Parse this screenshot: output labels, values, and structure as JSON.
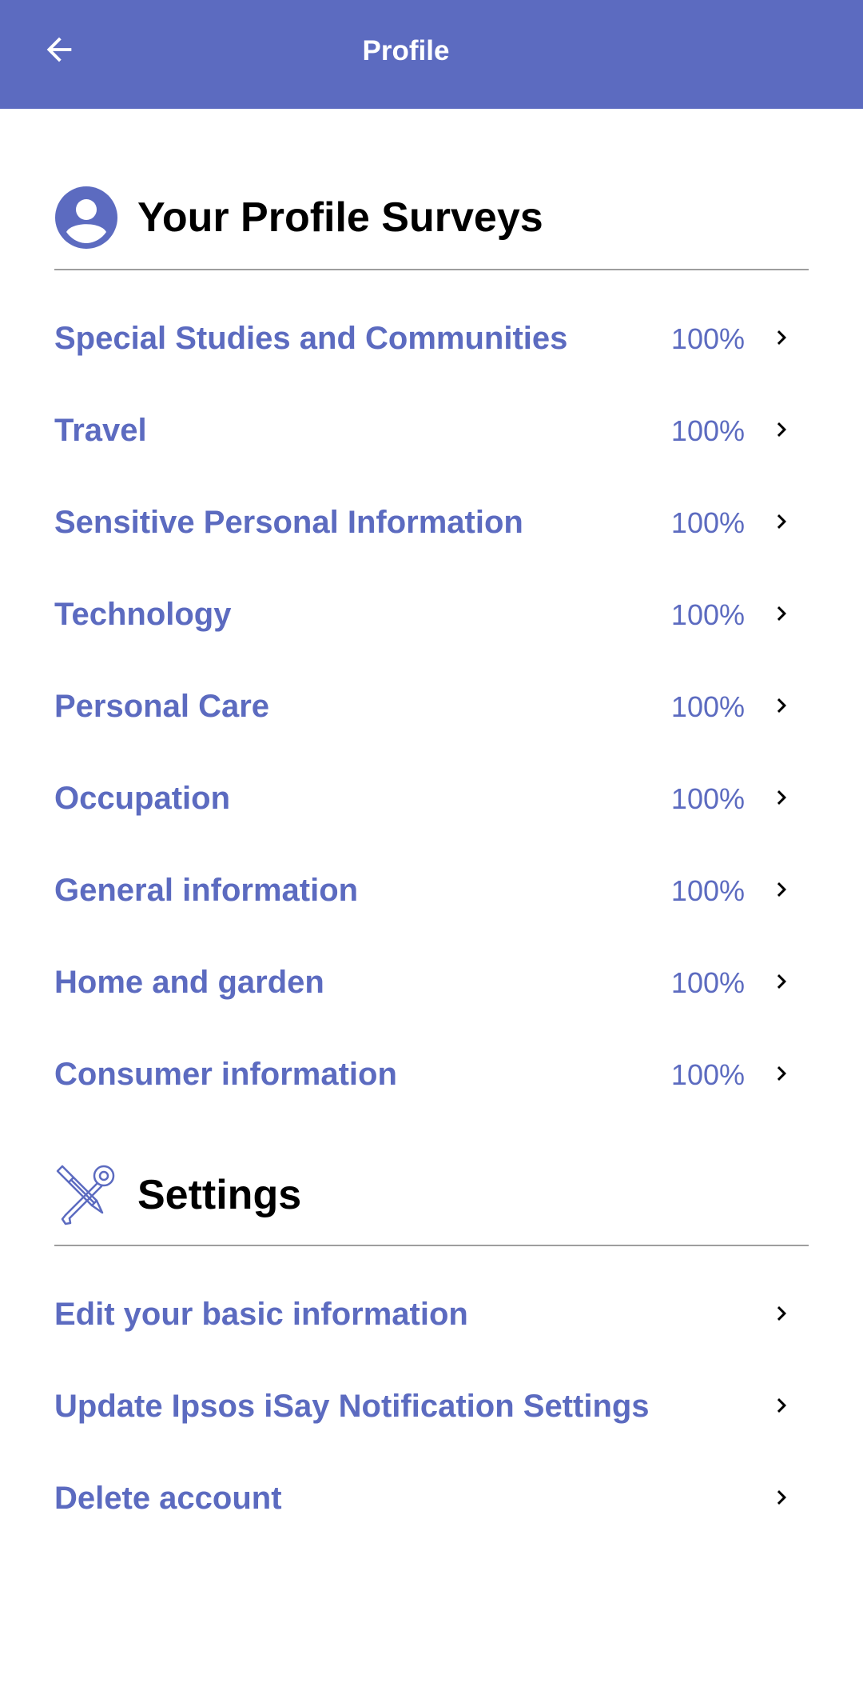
{
  "appbar": {
    "title": "Profile",
    "back_icon": "arrow-left-icon",
    "background": "#5c6bc0"
  },
  "profile_section": {
    "icon": "account-circle-icon",
    "title": "Your Profile Surveys",
    "items": [
      {
        "label": "Special Studies and Communities",
        "value": "100%"
      },
      {
        "label": "Travel",
        "value": "100%"
      },
      {
        "label": "Sensitive Personal Information",
        "value": "100%"
      },
      {
        "label": "Technology",
        "value": "100%"
      },
      {
        "label": "Personal Care",
        "value": "100%"
      },
      {
        "label": "Occupation",
        "value": "100%"
      },
      {
        "label": "General information",
        "value": "100%"
      },
      {
        "label": "Home and garden",
        "value": "100%"
      },
      {
        "label": "Consumer information",
        "value": "100%"
      }
    ]
  },
  "settings_section": {
    "icon": "tools-icon",
    "title": "Settings",
    "items": [
      {
        "label": "Edit your basic information"
      },
      {
        "label": "Update Ipsos iSay Notification Settings"
      },
      {
        "label": "Delete account"
      }
    ]
  },
  "colors": {
    "accent": "#5c6bc0",
    "divider": "#9e9e9e",
    "heading": "#000000"
  }
}
